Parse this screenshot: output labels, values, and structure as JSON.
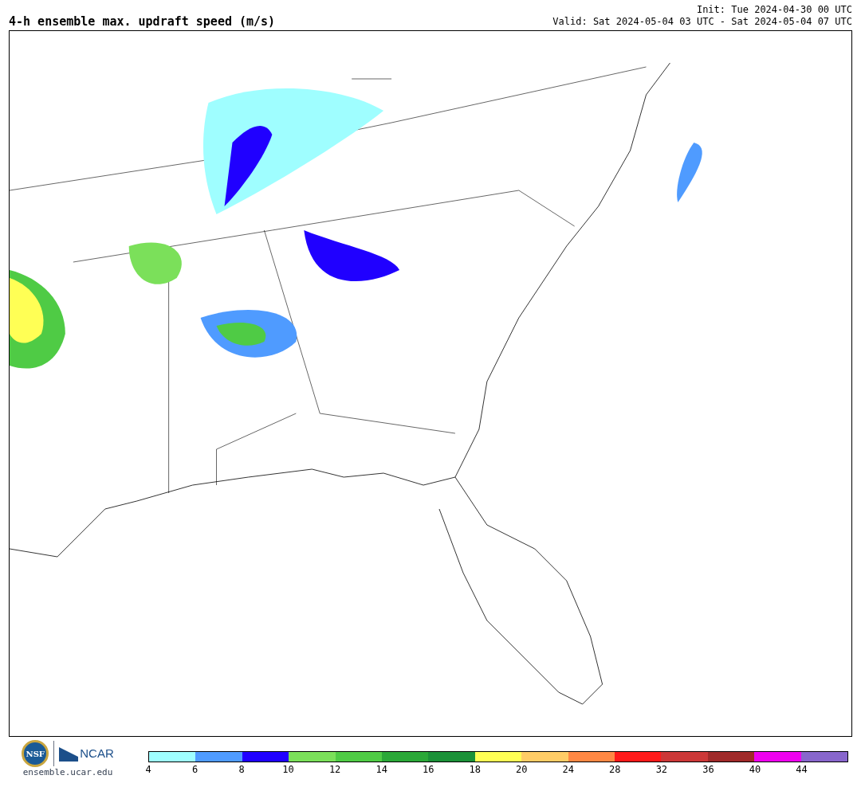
{
  "title": "4-h ensemble max. updraft speed (m/s)",
  "init": "Init: Tue 2024-04-30 00 UTC",
  "valid": "Valid: Sat 2024-05-04 03 UTC - Sat 2024-05-04 07 UTC",
  "logos": {
    "nsf": "NSF",
    "ncar": "NCAR",
    "url": "ensemble.ucar.edu"
  },
  "colorbar": [
    {
      "label": "4",
      "color": "#9ffeff"
    },
    {
      "label": "6",
      "color": "#4f9bff"
    },
    {
      "label": "8",
      "color": "#2000ff"
    },
    {
      "label": "10",
      "color": "#7be05a"
    },
    {
      "label": "12",
      "color": "#4fcb45"
    },
    {
      "label": "14",
      "color": "#2ba838"
    },
    {
      "label": "16",
      "color": "#1b9138"
    },
    {
      "label": "18",
      "color": "#ffff55"
    },
    {
      "label": "20",
      "color": "#ffcc66"
    },
    {
      "label": "24",
      "color": "#ff8844"
    },
    {
      "label": "28",
      "color": "#ff1a1a"
    },
    {
      "label": "32",
      "color": "#cc3838"
    },
    {
      "label": "36",
      "color": "#a02a2a"
    },
    {
      "label": "40",
      "color": "#ee00ee"
    },
    {
      "label": "44",
      "color": "#8866cc"
    }
  ]
}
